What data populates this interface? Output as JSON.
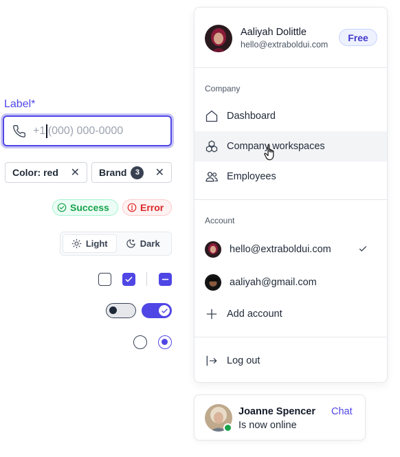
{
  "form": {
    "label": "Label*",
    "phone_prefix": "+1",
    "phone_placeholder": "(000) 000-0000"
  },
  "chips": [
    {
      "label": "Color: red",
      "remove": "✕"
    },
    {
      "label": "Brand",
      "count": "3",
      "remove": "✕"
    }
  ],
  "status": {
    "success": "Success",
    "error": "Error"
  },
  "theme": {
    "light": "Light",
    "dark": "Dark",
    "selected": "Light"
  },
  "controls": {
    "checkboxes": [
      "unchecked",
      "checked",
      "indeterminate"
    ],
    "toggles": [
      "off",
      "on"
    ],
    "radios": [
      "unselected",
      "selected"
    ]
  },
  "menu": {
    "user": {
      "name": "Aaliyah Dolittle",
      "email": "hello@extraboldui.com",
      "plan": "Free"
    },
    "company_title": "Company",
    "company_items": [
      "Dashboard",
      "Company workspaces",
      "Employees"
    ],
    "hovered_item": "Company workspaces",
    "account_title": "Account",
    "accounts": [
      {
        "email": "hello@extraboldui.com",
        "active": true
      },
      {
        "email": "aaliyah@gmail.com",
        "active": false
      }
    ],
    "add_account": "Add account",
    "logout": "Log out"
  },
  "notification": {
    "name": "Joanne Spencer",
    "status": "Is now online",
    "action": "Chat"
  },
  "colors": {
    "accent": "#4f46e5",
    "success": "#16a34a",
    "error": "#dc2626",
    "online": "#16a34a"
  },
  "icons": [
    "phone-icon",
    "close-icon",
    "check-circle-icon",
    "alert-circle-icon",
    "sun-icon",
    "moon-icon",
    "house-icon",
    "cubes-icon",
    "users-icon",
    "plus-icon",
    "logout-icon",
    "check-icon",
    "hand-cursor-icon"
  ]
}
